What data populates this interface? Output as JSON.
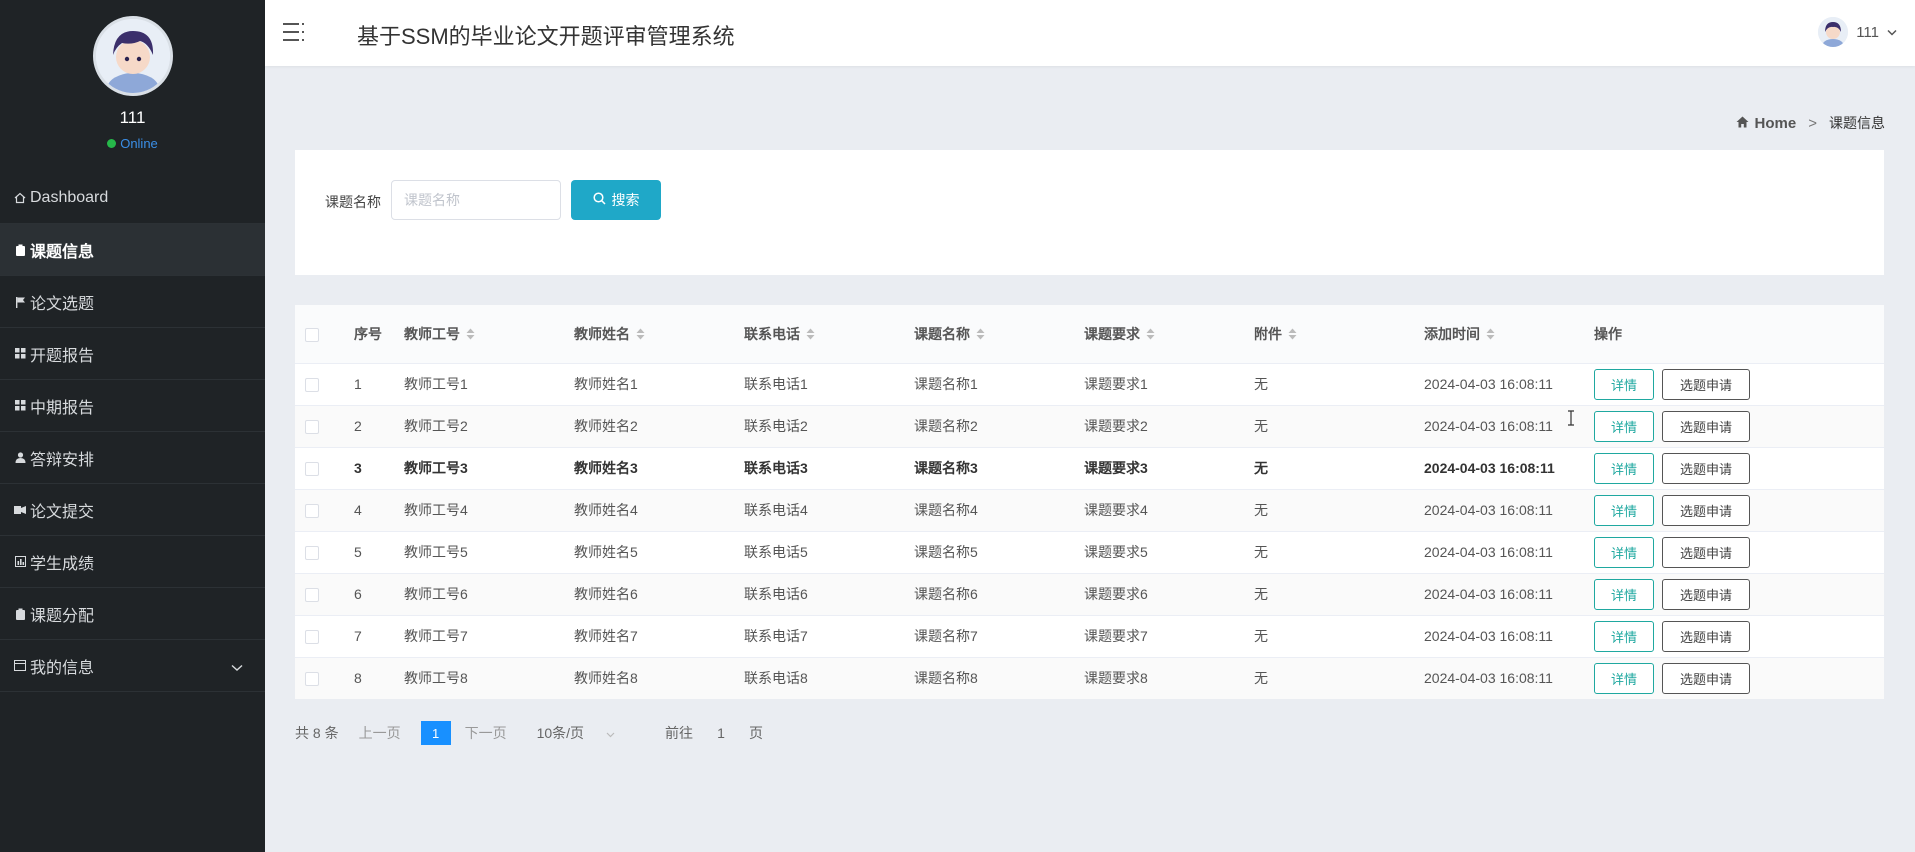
{
  "app": {
    "title": "基于SSM的毕业论文开题评审管理系统"
  },
  "profile": {
    "name": "111",
    "status": "Online"
  },
  "header": {
    "username": "111"
  },
  "sidebar": {
    "items": [
      {
        "label": "Dashboard",
        "icon": "home-icon",
        "active": false
      },
      {
        "label": "课题信息",
        "icon": "clipboard-icon",
        "active": true
      },
      {
        "label": "论文选题",
        "icon": "flag-icon",
        "active": false
      },
      {
        "label": "开题报告",
        "icon": "grid-icon",
        "active": false
      },
      {
        "label": "中期报告",
        "icon": "grid-icon",
        "active": false
      },
      {
        "label": "答辩安排",
        "icon": "user-icon",
        "active": false
      },
      {
        "label": "论文提交",
        "icon": "send-icon",
        "active": false
      },
      {
        "label": "学生成绩",
        "icon": "chart-icon",
        "active": false
      },
      {
        "label": "课题分配",
        "icon": "clipboard-icon",
        "active": false
      },
      {
        "label": "我的信息",
        "icon": "window-icon",
        "active": false,
        "expandable": true
      }
    ]
  },
  "breadcrumb": {
    "home": "Home",
    "separator": ">",
    "current": "课题信息"
  },
  "search": {
    "label": "课题名称",
    "placeholder": "课题名称",
    "value": "",
    "button": "搜索"
  },
  "table": {
    "headers": {
      "index": "序号",
      "teacher_id": "教师工号",
      "teacher_name": "教师姓名",
      "phone": "联系电话",
      "topic_name": "课题名称",
      "topic_req": "课题要求",
      "attachment": "附件",
      "added_time": "添加时间",
      "actions": "操作"
    },
    "detail_label": "详情",
    "apply_label": "选题申请",
    "rows": [
      {
        "index": "1",
        "teacher_id": "教师工号1",
        "teacher_name": "教师姓名1",
        "phone": "联系电话1",
        "topic_name": "课题名称1",
        "topic_req": "课题要求1",
        "attachment": "无",
        "added_time": "2024-04-03 16:08:11"
      },
      {
        "index": "2",
        "teacher_id": "教师工号2",
        "teacher_name": "教师姓名2",
        "phone": "联系电话2",
        "topic_name": "课题名称2",
        "topic_req": "课题要求2",
        "attachment": "无",
        "added_time": "2024-04-03 16:08:11"
      },
      {
        "index": "3",
        "teacher_id": "教师工号3",
        "teacher_name": "教师姓名3",
        "phone": "联系电话3",
        "topic_name": "课题名称3",
        "topic_req": "课题要求3",
        "attachment": "无",
        "added_time": "2024-04-03 16:08:11"
      },
      {
        "index": "4",
        "teacher_id": "教师工号4",
        "teacher_name": "教师姓名4",
        "phone": "联系电话4",
        "topic_name": "课题名称4",
        "topic_req": "课题要求4",
        "attachment": "无",
        "added_time": "2024-04-03 16:08:11"
      },
      {
        "index": "5",
        "teacher_id": "教师工号5",
        "teacher_name": "教师姓名5",
        "phone": "联系电话5",
        "topic_name": "课题名称5",
        "topic_req": "课题要求5",
        "attachment": "无",
        "added_time": "2024-04-03 16:08:11"
      },
      {
        "index": "6",
        "teacher_id": "教师工号6",
        "teacher_name": "教师姓名6",
        "phone": "联系电话6",
        "topic_name": "课题名称6",
        "topic_req": "课题要求6",
        "attachment": "无",
        "added_time": "2024-04-03 16:08:11"
      },
      {
        "index": "7",
        "teacher_id": "教师工号7",
        "teacher_name": "教师姓名7",
        "phone": "联系电话7",
        "topic_name": "课题名称7",
        "topic_req": "课题要求7",
        "attachment": "无",
        "added_time": "2024-04-03 16:08:11"
      },
      {
        "index": "8",
        "teacher_id": "教师工号8",
        "teacher_name": "教师姓名8",
        "phone": "联系电话8",
        "topic_name": "课题名称8",
        "topic_req": "课题要求8",
        "attachment": "无",
        "added_time": "2024-04-03 16:08:11"
      }
    ]
  },
  "pagination": {
    "total": "共 8 条",
    "prev": "上一页",
    "current_page": "1",
    "next": "下一页",
    "page_size": "10条/页",
    "goto_label": "前往",
    "goto_value": "1",
    "goto_suffix": "页"
  },
  "colors": {
    "sidebar_bg": "#1f2326",
    "accent": "#1fa8c8",
    "detail_btn": "#1fa8a0",
    "page_active": "#1890ff",
    "online": "#26b84a"
  }
}
